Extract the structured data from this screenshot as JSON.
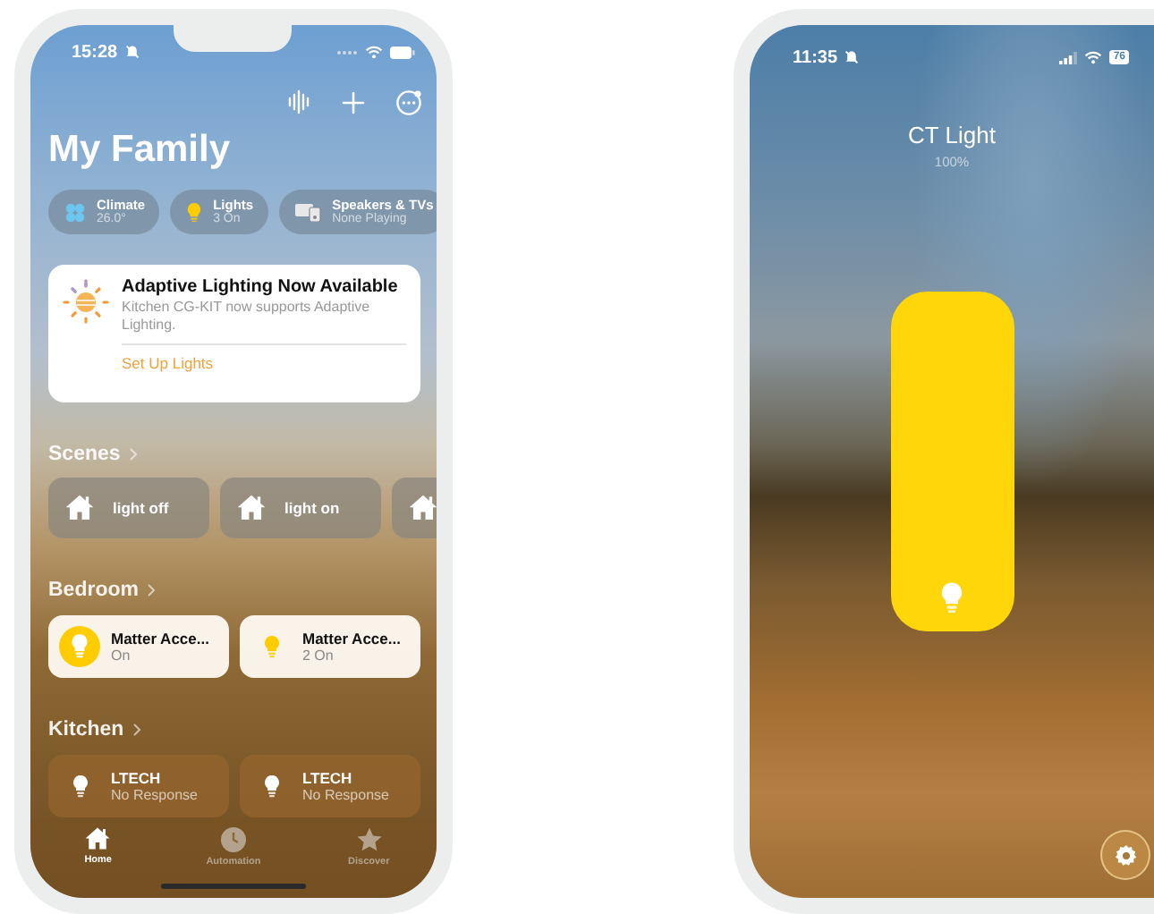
{
  "home_screen": {
    "status_bar": {
      "time": "15:28"
    },
    "title": "My Family",
    "summary_chips": [
      {
        "kind": "climate",
        "label": "Climate",
        "value": "26.0°"
      },
      {
        "kind": "lights",
        "label": "Lights",
        "value": "3 On"
      },
      {
        "kind": "speakers",
        "label": "Speakers & TVs",
        "value": "None Playing"
      }
    ],
    "notice": {
      "title": "Adaptive Lighting Now Available",
      "body": "Kitchen CG-KIT now supports Adaptive Lighting.",
      "action": "Set Up Lights"
    },
    "sections": [
      {
        "kind": "scenes",
        "title": "Scenes",
        "tiles": [
          {
            "kind": "scene",
            "name": "light off"
          },
          {
            "kind": "scene",
            "name": "light on"
          },
          {
            "kind": "scene"
          }
        ]
      },
      {
        "kind": "accessories",
        "title": "Bedroom",
        "tiles": [
          {
            "kind": "light",
            "name": "Matter Acce...",
            "status": "On",
            "on": true
          },
          {
            "kind": "group",
            "name": "Matter Acce...",
            "status": "2 On",
            "on": true
          }
        ]
      },
      {
        "kind": "accessories",
        "title": "Kitchen",
        "tiles": [
          {
            "kind": "light",
            "name": "LTECH",
            "status": "No Response",
            "on": false
          },
          {
            "kind": "light",
            "name": "LTECH",
            "status": "No Response",
            "on": false
          }
        ]
      }
    ],
    "tabs": [
      {
        "kind": "home",
        "label": "Home",
        "selected": true
      },
      {
        "kind": "automation",
        "label": "Automation",
        "selected": false
      },
      {
        "kind": "discover",
        "label": "Discover",
        "selected": false
      }
    ]
  },
  "light_screen": {
    "status_bar": {
      "time": "11:35",
      "battery": "76"
    },
    "title": "CT Light",
    "reading": "100%",
    "slider": {
      "level": 1
    }
  }
}
